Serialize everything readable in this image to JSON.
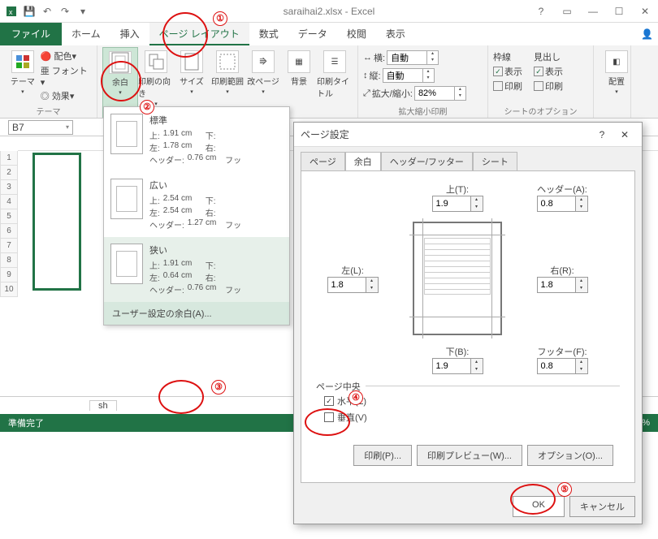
{
  "window": {
    "title": "saraihai2.xlsx - Excel"
  },
  "ribbon": {
    "file": "ファイル",
    "tabs": [
      "ホーム",
      "挿入",
      "ページ レイアウト",
      "数式",
      "データ",
      "校閲",
      "表示"
    ],
    "active": 2,
    "theme_group": {
      "themes": "テーマ",
      "colors": "配色",
      "fonts": "フォント",
      "effects": "効果",
      "title": "テーマ"
    },
    "pagesetup": {
      "margins": "余白",
      "orientation": "印刷の向き",
      "size": "サイズ",
      "printarea": "印刷範囲",
      "breaks": "改ページ",
      "background": "背景",
      "titles": "印刷タイトル"
    },
    "scale": {
      "width_lbl": "横:",
      "height_lbl": "縦:",
      "scale_lbl": "拡大/縮小:",
      "width_val": "自動",
      "height_val": "自動",
      "scale_val": "82%",
      "title": "拡大縮小印刷"
    },
    "sheetopt": {
      "gridlines": "枠線",
      "headings": "見出し",
      "view": "表示",
      "print": "印刷",
      "title": "シートのオプション"
    },
    "arrange": "配置"
  },
  "namebox": "B7",
  "margins_dropdown": {
    "items": [
      {
        "name": "標準",
        "top_l": "上:",
        "top": "1.91 cm",
        "bot_l": "下:",
        "left_l": "左:",
        "left": "1.78 cm",
        "right_l": "右:",
        "hdr_l": "ヘッダー:",
        "hdr": "0.76 cm",
        "ftr_l": "フッ"
      },
      {
        "name": "広い",
        "top_l": "上:",
        "top": "2.54 cm",
        "bot_l": "下:",
        "left_l": "左:",
        "left": "2.54 cm",
        "right_l": "右:",
        "hdr_l": "ヘッダー:",
        "hdr": "1.27 cm",
        "ftr_l": "フッ"
      },
      {
        "name": "狭い",
        "top_l": "上:",
        "top": "1.91 cm",
        "bot_l": "下:",
        "left_l": "左:",
        "left": "0.64 cm",
        "right_l": "右:",
        "hdr_l": "ヘッダー:",
        "hdr": "0.76 cm",
        "ftr_l": "フッ"
      }
    ],
    "custom": "ユーザー設定の余白(A)..."
  },
  "dialog": {
    "title": "ページ設定",
    "help": "?",
    "tabs": [
      "ページ",
      "余白",
      "ヘッダー/フッター",
      "シート"
    ],
    "active": 1,
    "top_lbl": "上(T):",
    "header_lbl": "ヘッダー(A):",
    "left_lbl": "左(L):",
    "right_lbl": "右(R):",
    "bottom_lbl": "下(B):",
    "footer_lbl": "フッター(F):",
    "values": {
      "top": "1.9",
      "header": "0.8",
      "left": "1.8",
      "right": "1.8",
      "bottom": "1.9",
      "footer": "0.8"
    },
    "center_legend": "ページ中央",
    "horiz": "水平(Z)",
    "vert": "垂直(V)",
    "horiz_checked": true,
    "vert_checked": false,
    "print_btn": "印刷(P)...",
    "preview_btn": "印刷プレビュー(W)...",
    "options_btn": "オプション(O)...",
    "ok": "OK",
    "cancel": "キャンセル"
  },
  "sheet": {
    "tab": "sh",
    "status": "準備完了",
    "rows": [
      "1",
      "2",
      "3",
      "4",
      "5",
      "6",
      "7",
      "8",
      "9",
      "10"
    ]
  },
  "annotations": {
    "n1": "①",
    "n2": "②",
    "n3": "③",
    "n4": "④",
    "n5": "⑤"
  }
}
